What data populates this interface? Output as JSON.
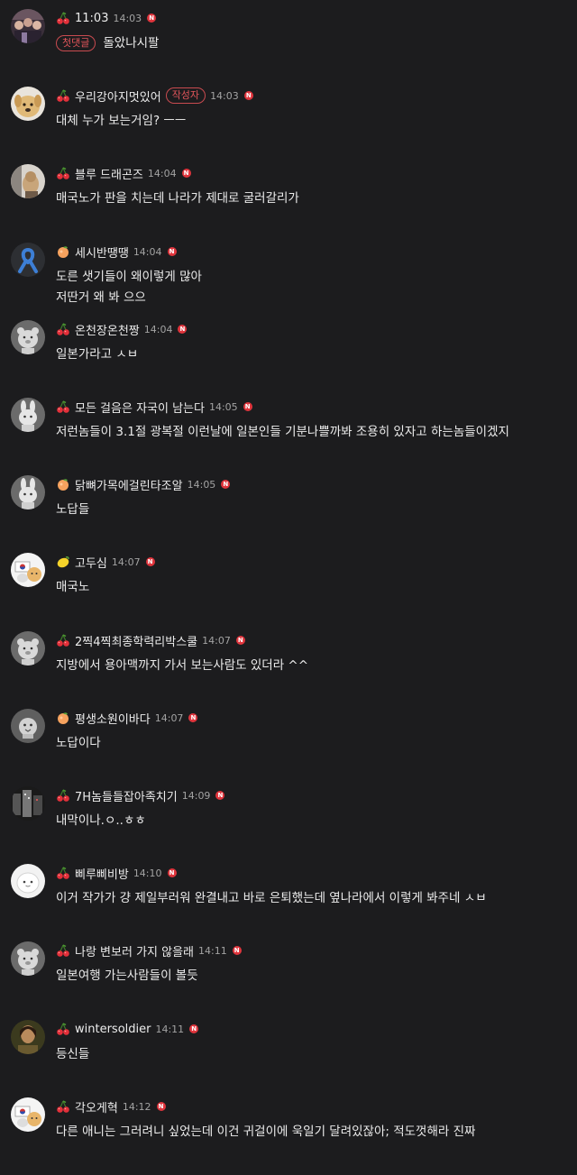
{
  "comments": [
    {
      "avatar": "photo-group",
      "level": "cherry",
      "nick": "11:03",
      "time": "14:03",
      "tag": "",
      "inline_tag": "첫댓글",
      "lines": [
        "돌았나시팔"
      ]
    },
    {
      "avatar": "puppy",
      "level": "cherry",
      "nick": "우리강아지멋있어",
      "time": "14:03",
      "tag": "작성자",
      "inline_tag": "",
      "lines": [
        "대체 누가 보는거임? ㅡㅡ"
      ]
    },
    {
      "avatar": "photo-dog",
      "level": "cherry",
      "nick": "블루 드래곤즈",
      "time": "14:04",
      "tag": "",
      "inline_tag": "",
      "lines": [
        "매국노가 판을 치는데 나라가 제대로 굴러갈리가"
      ]
    },
    {
      "avatar": "blue-ribbon",
      "level": "peach",
      "nick": "세시반땡땡",
      "time": "14:04",
      "tag": "",
      "inline_tag": "",
      "lines": [
        "도른 샛기들이 왜이렇게 많아",
        "저딴거 왜 봐 으으"
      ]
    },
    {
      "avatar": "bear",
      "level": "cherry",
      "nick": "온천장온천짱",
      "time": "14:04",
      "tag": "",
      "inline_tag": "",
      "lines": [
        "일본가라고 ㅅㅂ"
      ]
    },
    {
      "avatar": "bunny",
      "level": "cherry",
      "nick": "모든 걸음은 자국이 남는다",
      "time": "14:05",
      "tag": "",
      "inline_tag": "",
      "lines": [
        "저런놈들이 3.1절 광복절 이런날에 일본인들 기분나쁠까봐 조용히 있자고 하는놈들이겠지"
      ]
    },
    {
      "avatar": "bunny",
      "level": "peach",
      "nick": "닭뼈가목에걸린타조알",
      "time": "14:05",
      "tag": "",
      "inline_tag": "",
      "lines": [
        "노답들"
      ]
    },
    {
      "avatar": "flag-bear",
      "level": "lemon",
      "nick": "고두심",
      "time": "14:07",
      "tag": "",
      "inline_tag": "",
      "lines": [
        "매국노"
      ]
    },
    {
      "avatar": "bear",
      "level": "cherry",
      "nick": "2찍4찍최종학력리박스쿨",
      "time": "14:07",
      "tag": "",
      "inline_tag": "",
      "lines": [
        "지방에서 용아맥까지 가서 보는사람도 있더라 ^^"
      ]
    },
    {
      "avatar": "chick",
      "level": "peach",
      "nick": "평생소원이바다",
      "time": "14:07",
      "tag": "",
      "inline_tag": "",
      "lines": [
        "노답이다"
      ]
    },
    {
      "avatar": "photo-city",
      "level": "cherry",
      "nick": "7H놈들들잡아족치기",
      "time": "14:09",
      "tag": "",
      "inline_tag": "",
      "lines": [
        "내막이나.ㅇ..ㅎㅎ"
      ]
    },
    {
      "avatar": "white-round",
      "level": "cherry",
      "nick": "삐루삐비방",
      "time": "14:10",
      "tag": "",
      "inline_tag": "",
      "lines": [
        "이거 작가가 걍 제일부러워 완결내고 바로 은퇴했는데 옆나라에서 이렇게 봐주네 ㅅㅂ"
      ]
    },
    {
      "avatar": "bear",
      "level": "cherry",
      "nick": "나랑 변보러 가지 않을래",
      "time": "14:11",
      "tag": "",
      "inline_tag": "",
      "lines": [
        "일본여행 가는사람들이 볼듯"
      ]
    },
    {
      "avatar": "photo-person",
      "level": "cherry",
      "nick": "wintersoldier",
      "time": "14:11",
      "tag": "",
      "inline_tag": "",
      "lines": [
        "등신들"
      ]
    },
    {
      "avatar": "flag-bear",
      "level": "cherry",
      "nick": "각오게혁",
      "time": "14:12",
      "tag": "",
      "inline_tag": "",
      "lines": [
        "다른 애니는 그러려니 싶었는데 이건 귀걸이에 욱일기 달려있잖아; 적도껏해라 진짜"
      ]
    }
  ],
  "n_badge_text": "N",
  "colors": {
    "background": "#1c1c1e",
    "tag": "#e0555a",
    "badge": "#e0353d"
  }
}
